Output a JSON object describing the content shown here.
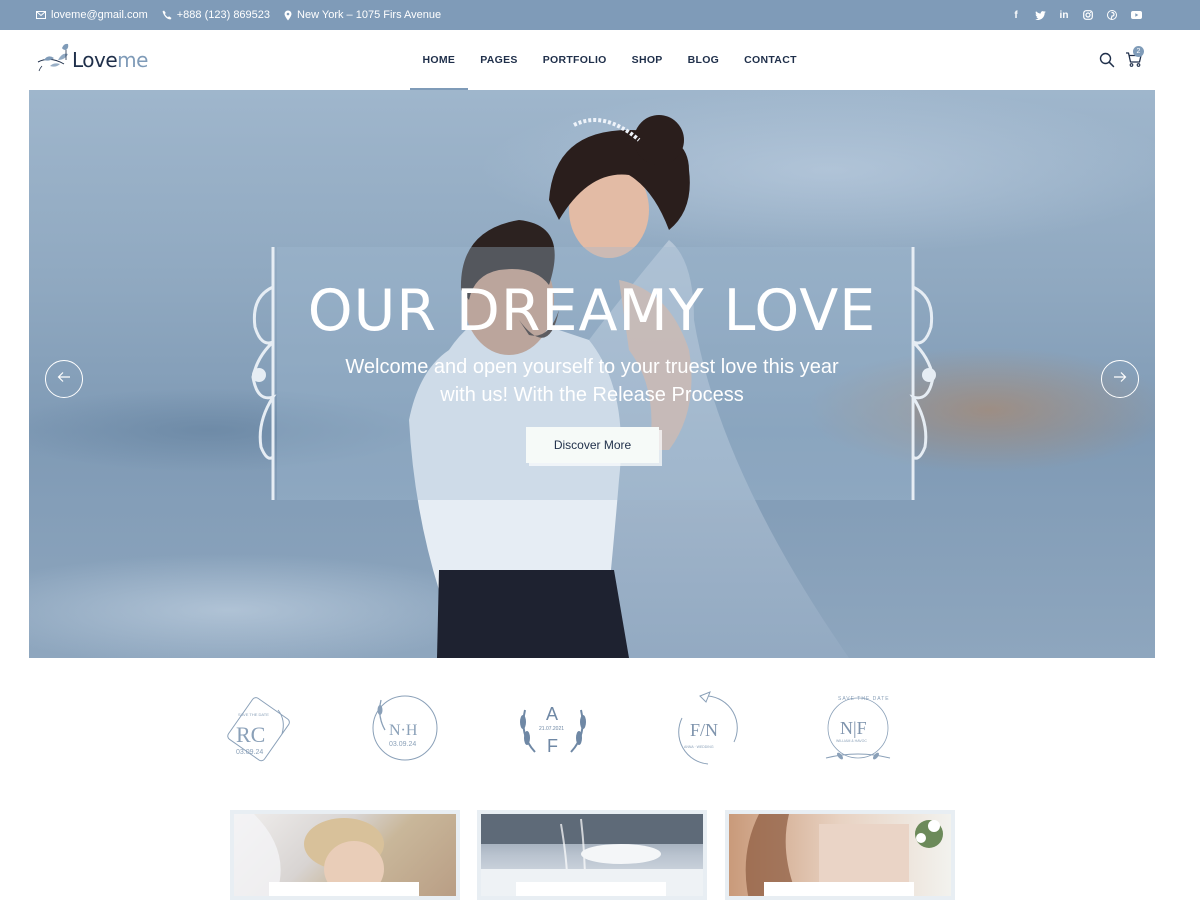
{
  "topbar": {
    "email": "loveme@gmail.com",
    "phone": "+888 (123) 869523",
    "address": "New York – 1075 Firs Avenue",
    "social_icons": [
      "facebook-icon",
      "twitter-icon",
      "linkedin-icon",
      "instagram-icon",
      "pinterest-icon",
      "youtube-icon"
    ],
    "social_glyphs": [
      "f",
      "t",
      "in",
      "◎",
      "p",
      "▶"
    ]
  },
  "logo": {
    "part1": "Love",
    "part2": "me"
  },
  "nav": {
    "items": [
      {
        "label": "HOME",
        "active": true
      },
      {
        "label": "PAGES"
      },
      {
        "label": "PORTFOLIO"
      },
      {
        "label": "SHOP"
      },
      {
        "label": "BLOG"
      },
      {
        "label": "CONTACT"
      }
    ]
  },
  "header": {
    "cart_count": "2"
  },
  "hero": {
    "title": "OUR DREAMY LOVE",
    "subtitle_line1": "Welcome and open yourself to your truest love this year",
    "subtitle_line2": "with us! With the Release Process",
    "cta_label": "Discover More"
  },
  "monograms": [
    {
      "letters": "RC",
      "date": "03.09.24",
      "small": "SAVE THE DATE"
    },
    {
      "letters": "N·H",
      "date": "03.09.24"
    },
    {
      "letters_top": "A",
      "letters_bottom": "F",
      "date": "21.07.2021"
    },
    {
      "letters": "F/N",
      "small": "ANNA · WEDDING"
    },
    {
      "letters": "N|F",
      "small": "SAVE THE DATE",
      "sub": "WILLIAM & HAVOC"
    }
  ],
  "colors": {
    "accent": "#7f9bb8",
    "navy": "#1f2f4a"
  }
}
